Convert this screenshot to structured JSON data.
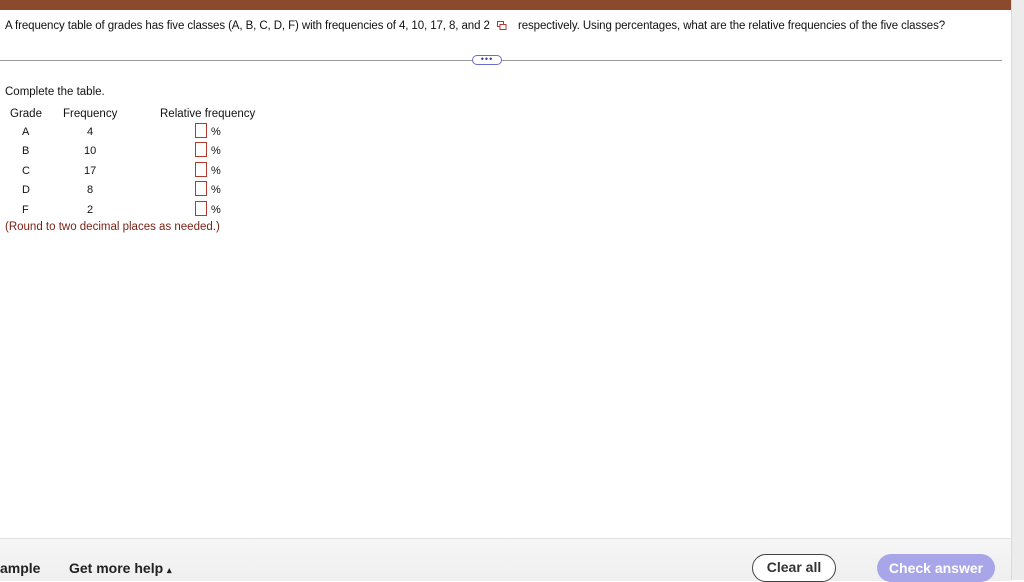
{
  "question": {
    "text_before": "A frequency table of grades has five classes (A, B, C, D, F) with frequencies of 4, 10, 17, 8, and 2",
    "text_after": "respectively. Using percentages, what are the relative frequencies of the five classes?"
  },
  "more_button_label": "•••",
  "instruction": "Complete the table.",
  "table": {
    "headers": [
      "Grade",
      "Frequency",
      "Relative frequency"
    ],
    "rows": [
      {
        "grade": "A",
        "frequency": "4",
        "value": "",
        "unit": "%"
      },
      {
        "grade": "B",
        "frequency": "10",
        "value": "",
        "unit": "%"
      },
      {
        "grade": "C",
        "frequency": "17",
        "value": "",
        "unit": "%"
      },
      {
        "grade": "D",
        "frequency": "8",
        "value": "",
        "unit": "%"
      },
      {
        "grade": "F",
        "frequency": "2",
        "value": "",
        "unit": "%"
      }
    ]
  },
  "hint": "(Round to two decimal places as needed.)",
  "footer": {
    "example_label": "ample",
    "help_label": "Get more help",
    "help_caret": "▴",
    "clear_label": "Clear all",
    "check_label": "Check answer"
  },
  "colors": {
    "topbar": "#8b4a2b",
    "input_border": "#b03a2e",
    "hint_text": "#7a1f12",
    "check_button": "#a8a6e8"
  },
  "icons": {
    "copy": "copy-icon"
  }
}
